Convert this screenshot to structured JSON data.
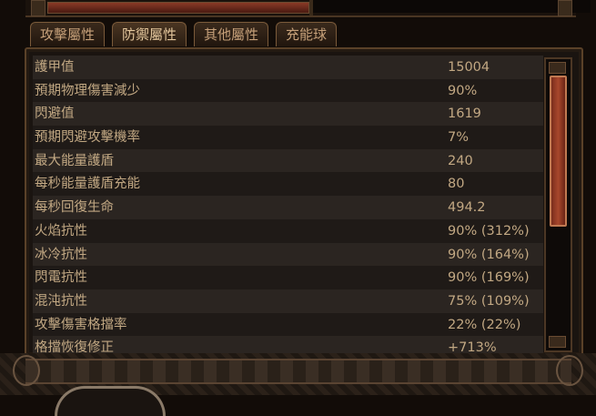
{
  "tabs": [
    {
      "label": "攻擊屬性",
      "active": false
    },
    {
      "label": "防禦屬性",
      "active": true
    },
    {
      "label": "其他屬性",
      "active": false
    },
    {
      "label": "充能球",
      "active": false
    }
  ],
  "stats": [
    {
      "label": "護甲值",
      "value": "15004"
    },
    {
      "label": "預期物理傷害減少",
      "value": "90%"
    },
    {
      "label": "閃避值",
      "value": "1619"
    },
    {
      "label": "預期閃避攻擊機率",
      "value": "7%"
    },
    {
      "label": "最大能量護盾",
      "value": "240"
    },
    {
      "label": "每秒能量護盾充能",
      "value": "80"
    },
    {
      "label": "每秒回復生命",
      "value": "494.2"
    },
    {
      "label": "火焰抗性",
      "value": "90% (312%)"
    },
    {
      "label": "冰冷抗性",
      "value": "90% (164%)"
    },
    {
      "label": "閃電抗性",
      "value": "90% (169%)"
    },
    {
      "label": "混沌抗性",
      "value": "75% (109%)"
    },
    {
      "label": "攻擊傷害格擋率",
      "value": "22% (22%)"
    },
    {
      "label": "格擋恢復修正",
      "value": "+713%"
    }
  ],
  "colors": {
    "text": "#c2a883",
    "accent": "#a8482c",
    "frame": "#5a4128"
  }
}
